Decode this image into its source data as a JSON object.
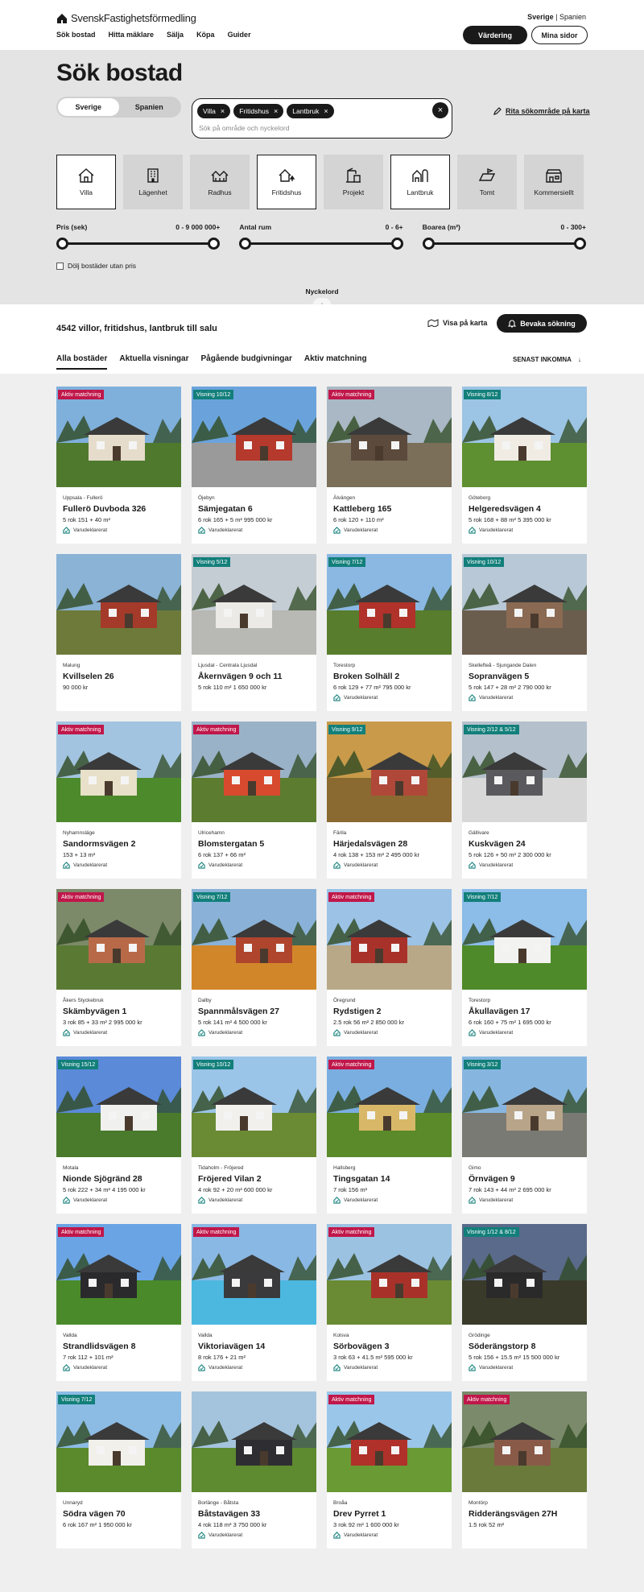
{
  "header": {
    "logo": "SvenskFastighetsförmedling",
    "nav": [
      "Sök bostad",
      "Hitta mäklare",
      "Sälja",
      "Köpa",
      "Guider"
    ],
    "lang_active": "Sverige",
    "lang_sep": "|",
    "lang_other": "Spanien",
    "valuation_label": "Värdering",
    "my_pages_label": "Mina sidor"
  },
  "search": {
    "title": "Sök bostad",
    "country_options": [
      "Sverige",
      "Spanien"
    ],
    "chips": [
      "Villa",
      "Fritidshus",
      "Lantbruk"
    ],
    "placeholder": "Sök på område och nyckelord",
    "draw_area": "Rita sökområde på karta",
    "types": [
      {
        "label": "Villa",
        "icon": "villa-icon",
        "selected": true
      },
      {
        "label": "Lägenhet",
        "icon": "apartment-icon",
        "selected": false
      },
      {
        "label": "Radhus",
        "icon": "rowhouse-icon",
        "selected": false
      },
      {
        "label": "Fritidshus",
        "icon": "cottage-icon",
        "selected": true
      },
      {
        "label": "Projekt",
        "icon": "project-icon",
        "selected": false
      },
      {
        "label": "Lantbruk",
        "icon": "farm-icon",
        "selected": true
      },
      {
        "label": "Tomt",
        "icon": "plot-icon",
        "selected": false
      },
      {
        "label": "Kommersiellt",
        "icon": "commercial-icon",
        "selected": false
      }
    ],
    "ranges": [
      {
        "label": "Pris (sek)",
        "value": "0 - 9 000 000+"
      },
      {
        "label": "Antal rum",
        "value": "0 - 6+"
      },
      {
        "label": "Boarea (m²)",
        "value": "0 - 300+"
      }
    ],
    "hide_no_price": "Dölj bostäder utan pris",
    "keyword": "Nyckelord"
  },
  "results": {
    "count_text": "4542 villor, fritidshus, lantbruk till salu",
    "show_map": "Visa på karta",
    "watch_search": "Bevaka sökning",
    "tabs": [
      "Alla bostäder",
      "Aktuella visningar",
      "Pågående budgivningar",
      "Aktiv matchning"
    ],
    "sort": "SENAST INKOMNA"
  },
  "declared_label": "Varudeklarerat",
  "listings": [
    {
      "badge": "Aktiv matchning",
      "badge_color": "red",
      "loc": "Uppsala - Fullerö",
      "addr": "Fullerö Duvboda 326",
      "det": "5 rok   151 + 40 m²",
      "declared": true,
      "sky": "#7fb0dc",
      "ground": "#4f7a2e",
      "house": "#e6dccb"
    },
    {
      "badge": "Visning 10/12",
      "badge_color": "teal",
      "loc": "Öjebyn",
      "addr": "Sämjegatan 6",
      "det": "6 rok   165 + 5 m²   995 000 kr",
      "declared": true,
      "sky": "#6aa3dc",
      "ground": "#9a9a9a",
      "house": "#b5392c"
    },
    {
      "badge": "Aktiv matchning",
      "badge_color": "red",
      "loc": "Älvängen",
      "addr": "Kattleberg 165",
      "det": "6 rok   120 + 110 m²",
      "declared": true,
      "sky": "#a9b8c4",
      "ground": "#7b6f5a",
      "house": "#5c4a3c"
    },
    {
      "badge": "Visning 8/12",
      "badge_color": "teal",
      "loc": "Göteborg",
      "addr": "Helgeredsvägen 4",
      "det": "5 rok   168 + 88 m²   5 395 000 kr",
      "declared": true,
      "sky": "#9cc4e4",
      "ground": "#5e8f31",
      "house": "#f0ece4"
    },
    {
      "badge": "",
      "badge_color": "",
      "loc": "Malung",
      "addr": "Kvillselen 26",
      "det": "90 000 kr",
      "declared": false,
      "sky": "#8ab3d6",
      "ground": "#6d7a3a",
      "house": "#a43a2a"
    },
    {
      "badge": "Visning 5/12",
      "badge_color": "teal",
      "loc": "Ljusdal - Centrala Ljusdal",
      "addr": "Åkernvägen 9 och 11",
      "det": "5 rok   110 m²   1 650 000 kr",
      "declared": false,
      "sky": "#c4ccd4",
      "ground": "#b8b8b4",
      "house": "#eceae6"
    },
    {
      "badge": "Visning 7/12",
      "badge_color": "teal",
      "loc": "Torestorp",
      "addr": "Broken Solhäll 2",
      "det": "6 rok   129 + 77 m²   795 000 kr",
      "declared": true,
      "sky": "#8ab8e2",
      "ground": "#587d2c",
      "house": "#b0322a"
    },
    {
      "badge": "Visning 10/12",
      "badge_color": "teal",
      "loc": "Skellefteå - Sjungande Dalen",
      "addr": "Sopranvägen 5",
      "det": "5 rok   147 + 28 m²   2 790 000 kr",
      "declared": true,
      "sky": "#b8c8d6",
      "ground": "#6b5d4e",
      "house": "#8a6a52"
    },
    {
      "badge": "Aktiv matchning",
      "badge_color": "red",
      "loc": "Nyhamnsläge",
      "addr": "Sandormsvägen 2",
      "det": "153 + 13 m²",
      "declared": true,
      "sky": "#a2c4e0",
      "ground": "#4d8a2c",
      "house": "#e8e0c8"
    },
    {
      "badge": "Aktiv matchning",
      "badge_color": "red",
      "loc": "Ulricehamn",
      "addr": "Blomstergatan 5",
      "det": "6 rok   137 + 66 m²",
      "declared": true,
      "sky": "#9ab2c8",
      "ground": "#5c7d30",
      "house": "#d84a2e"
    },
    {
      "badge": "Visning 9/12",
      "badge_color": "teal",
      "loc": "Färila",
      "addr": "Härjedalsvägen 28",
      "det": "4 rok   138 + 153 m²   2 495 000 kr",
      "declared": true,
      "sky": "#c89a4a",
      "ground": "#8a6a30",
      "house": "#b0483a"
    },
    {
      "badge": "Visning 2/12 & 5/12",
      "badge_color": "teal",
      "loc": "Gällivare",
      "addr": "Kuskvägen 24",
      "det": "5 rok   126 + 50 m²   2 300 000 kr",
      "declared": true,
      "sky": "#b4c0cc",
      "ground": "#d8d8d8",
      "house": "#5a5a5e"
    },
    {
      "badge": "Aktiv matchning",
      "badge_color": "red",
      "loc": "Åkers Styckebruk",
      "addr": "Skämbyvägen 1",
      "det": "3 rok   85 + 33 m²   2 995 000 kr",
      "declared": true,
      "sky": "#7c8a6a",
      "ground": "#5a7a34",
      "house": "#b86a48"
    },
    {
      "badge": "Visning 7/12",
      "badge_color": "teal",
      "loc": "Dalby",
      "addr": "Spannmålsvägen 27",
      "det": "5 rok   141 m²   4 500 000 kr",
      "declared": true,
      "sky": "#8ab2d8",
      "ground": "#d2862a",
      "house": "#b0452e"
    },
    {
      "badge": "Aktiv matchning",
      "badge_color": "red",
      "loc": "Öregrund",
      "addr": "Rydstigen 2",
      "det": "2.5 rok   56 m²   2 850 000 kr",
      "declared": true,
      "sky": "#9cc2e6",
      "ground": "#b8a888",
      "house": "#a8322a"
    },
    {
      "badge": "Visning 7/12",
      "badge_color": "teal",
      "loc": "Torestorp",
      "addr": "Åkullavägen 17",
      "det": "6 rok   160 + 75 m²   1 695 000 kr",
      "declared": true,
      "sky": "#8cbce8",
      "ground": "#4f8a2a",
      "house": "#f2f2f0"
    },
    {
      "badge": "Visning 15/12",
      "badge_color": "teal",
      "loc": "Motala",
      "addr": "Nionde Sjögränd 28",
      "det": "5 rok   222 + 34 m²   4 195 000 kr",
      "declared": true,
      "sky": "#5a8ad8",
      "ground": "#4a7a2c",
      "house": "#f0f0ee"
    },
    {
      "badge": "Visning 10/12",
      "badge_color": "teal",
      "loc": "Tidaholm - Fröjered",
      "addr": "Fröjered Vilan 2",
      "det": "4 rok   92 + 20 m²   600 000 kr",
      "declared": true,
      "sky": "#9ac4e8",
      "ground": "#6a8a34",
      "house": "#f2f0ec"
    },
    {
      "badge": "Aktiv matchning",
      "badge_color": "red",
      "loc": "Hallsberg",
      "addr": "Tingsgatan 14",
      "det": "7 rok   156 m²",
      "declared": true,
      "sky": "#7aaee0",
      "ground": "#5a8a2a",
      "house": "#d8b868"
    },
    {
      "badge": "Visning 3/12",
      "badge_color": "teal",
      "loc": "Gimo",
      "addr": "Örnvägen 9",
      "det": "7 rok   143 + 44 m²   2 695 000 kr",
      "declared": true,
      "sky": "#86b6e0",
      "ground": "#7a7a74",
      "house": "#b8a488"
    },
    {
      "badge": "Aktiv matchning",
      "badge_color": "red",
      "loc": "Vallda",
      "addr": "Strandlidsvägen 8",
      "det": "7 rok   112 + 101 m²",
      "declared": true,
      "sky": "#6aa4e4",
      "ground": "#4a8a2a",
      "house": "#2a2a2c"
    },
    {
      "badge": "Aktiv matchning",
      "badge_color": "red",
      "loc": "Vallda",
      "addr": "Viktoriavägen 14",
      "det": "8 rok   176 + 21 m²",
      "declared": true,
      "sky": "#8ab8e4",
      "ground": "#4cb8e0",
      "house": "#3a3a3c"
    },
    {
      "badge": "Aktiv matchning",
      "badge_color": "red",
      "loc": "Kolsva",
      "addr": "Sörbovägen 3",
      "det": "3 rok   63 + 41.5 m²   595 000 kr",
      "declared": true,
      "sky": "#9cc2e2",
      "ground": "#6a8a34",
      "house": "#a8322a"
    },
    {
      "badge": "Visning 1/12 & 8/12",
      "badge_color": "teal",
      "loc": "Grödinge",
      "addr": "Söderängstorp 8",
      "det": "5 rok   156 + 15.5 m²   15 500 000 kr",
      "declared": true,
      "sky": "#5a6a8a",
      "ground": "#3a3a2a",
      "house": "#2a2a2a"
    },
    {
      "badge": "Visning 7/12",
      "badge_color": "teal",
      "loc": "Unnaryd",
      "addr": "Södra vägen 70",
      "det": "6 rok   167 m²   1 950 000 kr",
      "declared": false,
      "sky": "#8cbce4",
      "ground": "#5a8a2c",
      "house": "#f2f0ea"
    },
    {
      "badge": "",
      "badge_color": "",
      "loc": "Borlänge - Båtsta",
      "addr": "Båtstavägen 33",
      "det": "4 rok   118 m²   3 750 000 kr",
      "declared": true,
      "sky": "#a4c4de",
      "ground": "#5e8a30",
      "house": "#2e2e32"
    },
    {
      "badge": "Aktiv matchning",
      "badge_color": "red",
      "loc": "Broåa",
      "addr": "Drev Pyrret 1",
      "det": "3 rok   92 m²   1 600 000 kr",
      "declared": true,
      "sky": "#9ac6ea",
      "ground": "#6a9a34",
      "house": "#b0302a"
    },
    {
      "badge": "Aktiv matchning",
      "badge_color": "red",
      "loc": "Montörp",
      "addr": "Ridderängsvägen 27H",
      "det": "1.5 rok   52 m²",
      "declared": false,
      "sky": "#7a8a6a",
      "ground": "#6a7a3a",
      "house": "#8a5a48"
    }
  ]
}
